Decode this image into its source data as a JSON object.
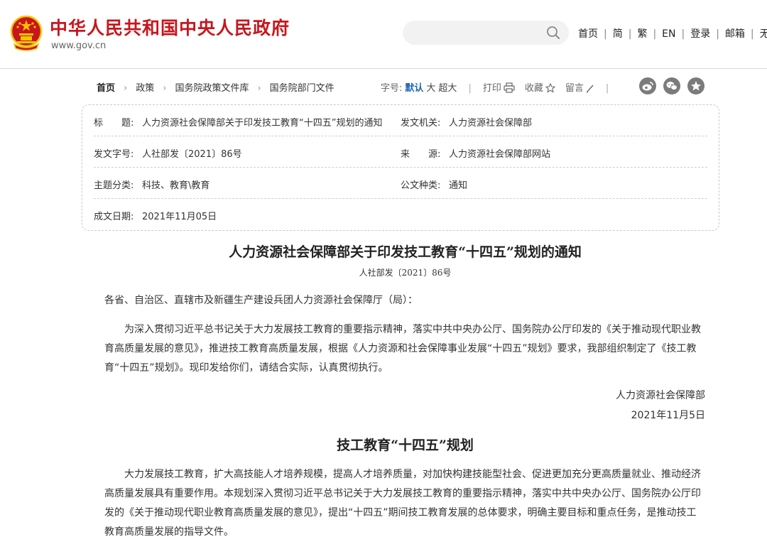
{
  "header": {
    "site_title": "中华人民共和国中央人民政府",
    "site_url": "www.gov.cn",
    "links": [
      "首页",
      "简",
      "繁",
      "EN",
      "登录",
      "邮箱",
      "无"
    ],
    "search_placeholder": ""
  },
  "toolbar": {
    "breadcrumb": [
      "首页",
      "政策",
      "国务院政策文件库",
      "国务院部门文件"
    ],
    "font_size_label": "字号:",
    "font_size_options": [
      "默认",
      "大",
      "超大"
    ],
    "active_font_size": "默认",
    "print_label": "打印",
    "favorite_label": "收藏",
    "comment_label": "留言",
    "share_icons": [
      "weibo-icon",
      "wechat-icon",
      "star-icon"
    ]
  },
  "meta": {
    "title_key": "标　　题:",
    "title_value": "人力资源社会保障部关于印发技工教育“十四五”规划的通知",
    "issuer_key": "发文机关:",
    "issuer_value": "人力资源社会保障部",
    "doc_no_key": "发文字号:",
    "doc_no_value": "人社部发〔2021〕86号",
    "source_key": "来　　源:",
    "source_value": "人力资源社会保障部网站",
    "category_key": "主题分类:",
    "category_value": "科技、教育\\教育",
    "type_key": "公文种类:",
    "type_value": "通知",
    "date_key": "成文日期:",
    "date_value": "2021年11月05日"
  },
  "article": {
    "title": "人力资源社会保障部关于印发技工教育“十四五”规划的通知",
    "doc_number": "人社部发〔2021〕86号",
    "salutation": "各省、自治区、直辖市及新疆生产建设兵团人力资源社会保障厅（局）：",
    "body": "为深入贯彻习近平总书记关于大力发展技工教育的重要指示精神，落实中共中央办公厅、国务院办公厅印发的《关于推动现代职业教育高质量发展的意见》，推进技工教育高质量发展，根据《人力资源和社会保障事业发展“十四五”规划》要求，我部组织制定了《技工教育“十四五”规划》。现印发给你们，请结合实际，认真贯彻执行。",
    "signer": "人力资源社会保障部",
    "sign_date": "2021年11月5日",
    "plan_title": "技工教育“十四五”规划",
    "plan_intro": "大力发展技工教育，扩大高技能人才培养规模，提高人才培养质量，对加快构建技能型社会、促进更加充分更高质量就业、推动经济高质量发展具有重要作用。本规划深入贯彻习近平总书记关于大力发展技工教育的重要指示精神，落实中共中央办公厅、国务院办公厅印发的《关于推动现代职业教育高质量发展的意见》，提出“十四五”期间技工教育发展的总体要求，明确主要目标和重点任务，是推动技工教育高质量发展的指导文件。"
  },
  "colors": {
    "brand_red": "#c8161d",
    "emblem_gold": "#f5c400",
    "active_blue": "#1e64b4"
  }
}
